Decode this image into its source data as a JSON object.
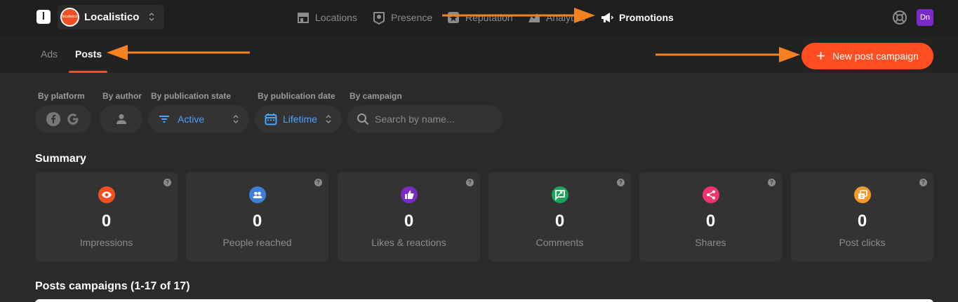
{
  "topbar": {
    "brand_letter": "l",
    "org_name": "Localistico",
    "org_avatar_text": "localistico",
    "nav": [
      {
        "label": "Locations",
        "icon": "store-icon"
      },
      {
        "label": "Presence",
        "icon": "location-badge-icon"
      },
      {
        "label": "Reputation",
        "icon": "star-badge-icon"
      },
      {
        "label": "Analytics",
        "icon": "chart-icon"
      },
      {
        "label": "Promotions",
        "icon": "megaphone-icon"
      }
    ],
    "user_initials": "Dn"
  },
  "subbar": {
    "tabs": [
      "Ads",
      "Posts"
    ],
    "active_tab": "Posts",
    "new_campaign_label": "New post campaign"
  },
  "filters": {
    "platform_label": "By platform",
    "author_label": "By author",
    "state_label": "By publication state",
    "state_value": "Active",
    "date_label": "By publication date",
    "date_value": "Lifetime",
    "campaign_label": "By campaign",
    "search_placeholder": "Search by name..."
  },
  "summary": {
    "title": "Summary",
    "cards": [
      {
        "value": "0",
        "label": "Impressions",
        "icon": "eye-icon",
        "color": "#f04e23"
      },
      {
        "value": "0",
        "label": "People reached",
        "icon": "people-icon",
        "color": "#3d7fd9"
      },
      {
        "value": "0",
        "label": "Likes & reactions",
        "icon": "thumbs-up-icon",
        "color": "#7a2bc7"
      },
      {
        "value": "0",
        "label": "Comments",
        "icon": "comment-icon",
        "color": "#1aa35a"
      },
      {
        "value": "0",
        "label": "Shares",
        "icon": "share-icon",
        "color": "#f0336e"
      },
      {
        "value": "0",
        "label": "Post clicks",
        "icon": "click-icon",
        "color": "#f39a2b"
      }
    ]
  },
  "campaigns": {
    "title": "Posts campaigns (1-17 of 17)"
  },
  "colors": {
    "accent": "#ff4d21",
    "annotation_arrow": "#f5821f",
    "link_blue": "#4aa3ff"
  }
}
